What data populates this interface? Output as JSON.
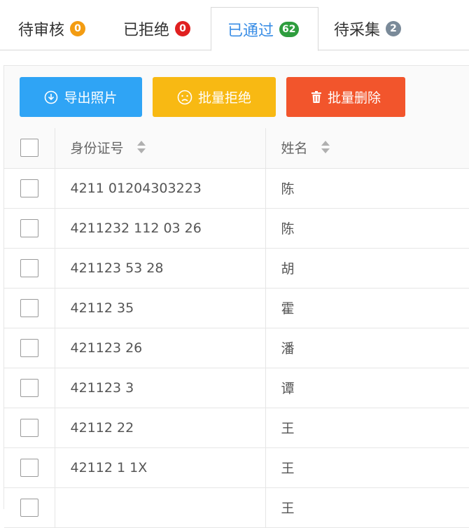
{
  "tabs": [
    {
      "label": "待审核",
      "count": "0",
      "badge_color": "#f39c12"
    },
    {
      "label": "已拒绝",
      "count": "0",
      "badge_color": "#e02020"
    },
    {
      "label": "已通过",
      "count": "62",
      "badge_color": "#2e9d3e"
    },
    {
      "label": "待采集",
      "count": "2",
      "badge_color": "#7a8a99"
    }
  ],
  "toolbar": {
    "export_label": "导出照片",
    "reject_label": "批量拒绝",
    "delete_label": "批量删除",
    "export_color": "#2fa4f5",
    "reject_color": "#f8b913",
    "delete_color": "#f2552c"
  },
  "table": {
    "columns": [
      "身份证号",
      "姓名"
    ],
    "rows": [
      {
        "id": "4211   01204303223",
        "name": "陈"
      },
      {
        "id": "4211232  112 03  26",
        "name": "陈"
      },
      {
        "id": "421123       53  28",
        "name": "胡"
      },
      {
        "id": "42112        35",
        "name": "霍"
      },
      {
        "id": "421123          26",
        "name": "潘"
      },
      {
        "id": "421123            3",
        "name": "谭"
      },
      {
        "id": "42112           22",
        "name": "王"
      },
      {
        "id": "42112     1    1X",
        "name": "王"
      },
      {
        "id": "",
        "name": "王"
      }
    ]
  },
  "icons": {
    "export": "download-circle-icon",
    "reject": "sad-face-icon",
    "delete": "trash-icon",
    "sort": "sort-icon"
  }
}
